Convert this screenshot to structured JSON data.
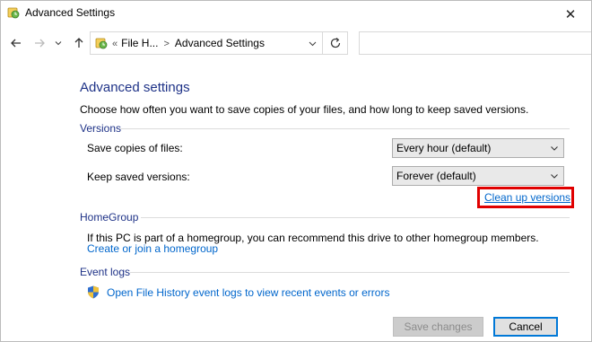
{
  "window": {
    "title": "Advanced Settings",
    "close_glyph": "✕"
  },
  "nav": {
    "back_icon": "arrow-left-icon",
    "forward_icon": "arrow-right-icon",
    "recent_icon": "chevron-down-icon",
    "up_icon": "arrow-up-icon",
    "breadcrumb": {
      "overflow": "«",
      "parent": "File H...",
      "current": "Advanced Settings"
    },
    "refresh_icon": "refresh-icon",
    "search_placeholder": ""
  },
  "page": {
    "title": "Advanced settings",
    "intro": "Choose how often you want to save copies of your files, and how long to keep saved versions."
  },
  "versions": {
    "label": "Versions",
    "save_copies_label": "Save copies of files:",
    "save_copies_value": "Every hour (default)",
    "keep_versions_label": "Keep saved versions:",
    "keep_versions_value": "Forever (default)",
    "cleanup_link": "Clean up versions"
  },
  "homegroup": {
    "label": "HomeGroup",
    "text": "If this PC is part of a homegroup, you can recommend this drive to other homegroup members.",
    "link": "Create or join a homegroup"
  },
  "event_logs": {
    "label": "Event logs",
    "link": "Open File History event logs to view recent events or errors",
    "icon": "shield-icon"
  },
  "buttons": {
    "save": "Save changes",
    "cancel": "Cancel"
  },
  "colors": {
    "heading": "#1e3287",
    "link": "#0066cc",
    "highlight": "#e00000"
  }
}
